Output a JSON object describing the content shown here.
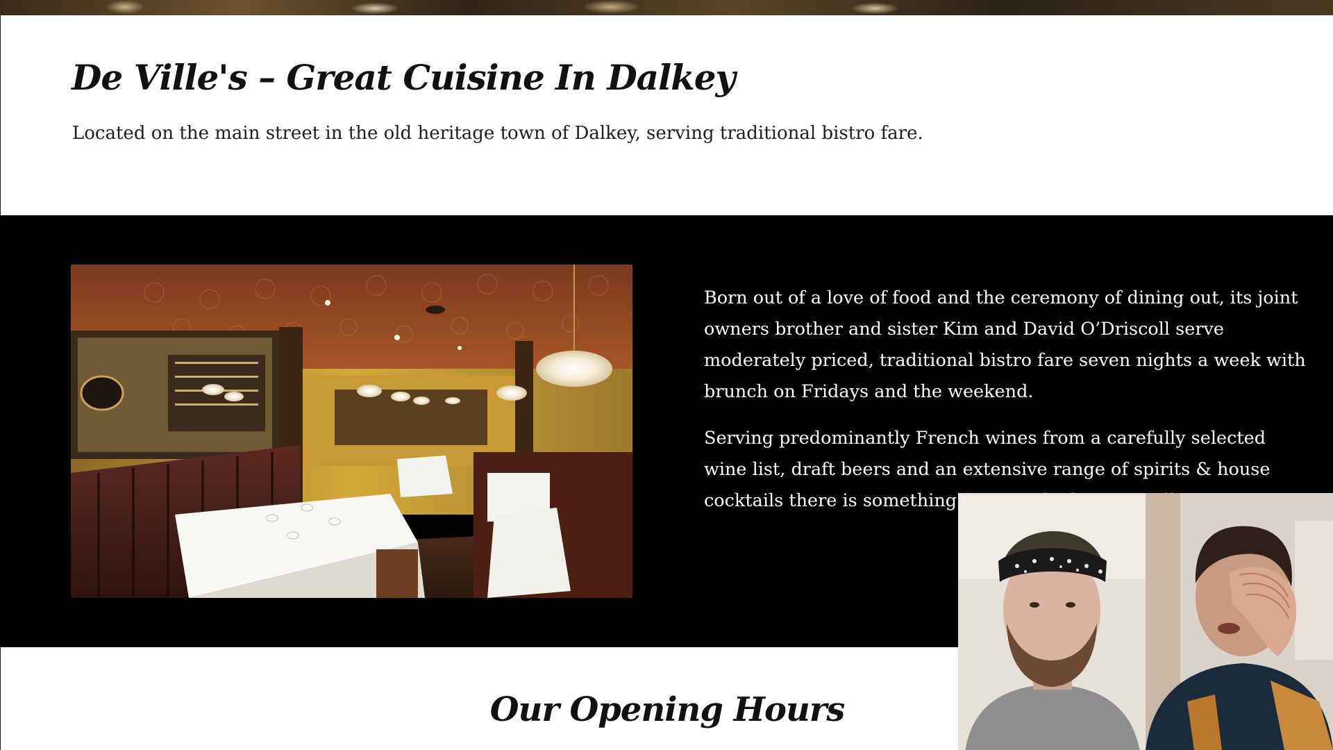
{
  "intro": {
    "title": "De Ville's – Great Cuisine In Dalkey",
    "tagline": "Located on the main street in the old heritage town of Dalkey, serving traditional bistro fare."
  },
  "about": {
    "paragraph_1": "Born out of a love of food and the ceremony of dining out, its joint owners brother and sister Kim and David O’Driscoll serve moderately priced, traditional bistro fare seven nights a week with brunch on Fridays and the weekend.",
    "paragraph_2": "Serving predominantly French wines from a carefully selected wine list, draft beers and an extensive range of spirits & house cocktails there is something for everybody at De Ville's."
  },
  "hours": {
    "title": "Our Opening Hours"
  },
  "colors": {
    "about_background": "#000000",
    "page_background": "#ffffff",
    "text_dark": "#111111",
    "text_light": "#ffffff"
  }
}
